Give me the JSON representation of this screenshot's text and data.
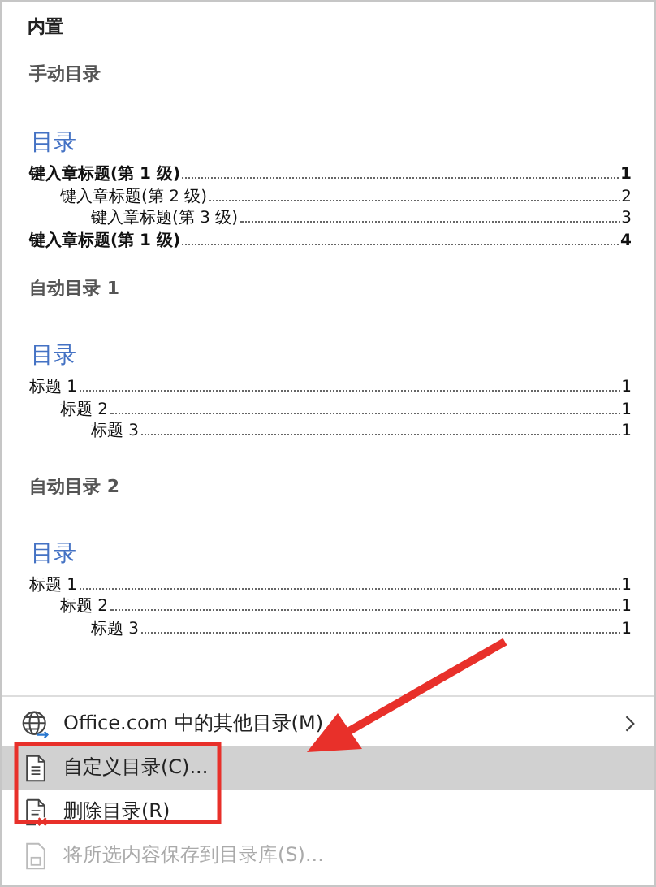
{
  "header": "内置",
  "gallery": [
    {
      "title": "手动目录",
      "toc_title": "目录",
      "entries": [
        {
          "text": "键入章标题(第 1 级)",
          "page": "1",
          "bold": true,
          "children": [
            {
              "text": "键入章标题(第 2 级)",
              "page": "2",
              "bold": false,
              "children": [
                {
                  "text": "键入章标题(第 3 级)",
                  "page": "3",
                  "bold": false
                }
              ]
            }
          ]
        },
        {
          "text": "键入章标题(第 1 级)",
          "page": "4",
          "bold": true
        }
      ]
    },
    {
      "title": "自动目录 1",
      "toc_title": "目录",
      "entries": [
        {
          "text": "标题 1",
          "page": "1",
          "bold": false,
          "children": [
            {
              "text": "标题 2",
              "page": "1",
              "bold": false,
              "children": [
                {
                  "text": "标题 3",
                  "page": "1",
                  "bold": false
                }
              ]
            }
          ]
        }
      ]
    },
    {
      "title": "自动目录 2",
      "toc_title": "目录",
      "entries": [
        {
          "text": "标题 1",
          "page": "1",
          "bold": false,
          "children": [
            {
              "text": "标题 2",
              "page": "1",
              "bold": false,
              "children": [
                {
                  "text": "标题 3",
                  "page": "1",
                  "bold": false
                }
              ]
            }
          ]
        }
      ]
    }
  ],
  "menu": [
    {
      "label": "Office.com 中的其他目录(M)",
      "kind": "globe",
      "submenu": true,
      "selected": false,
      "disabled": false
    },
    {
      "label": "自定义目录(C)...",
      "kind": "document",
      "submenu": false,
      "selected": true,
      "disabled": false
    },
    {
      "label": "删除目录(R)",
      "kind": "delete",
      "submenu": false,
      "selected": false,
      "disabled": false
    },
    {
      "label": "将所选内容保存到目录库(S)...",
      "kind": "save",
      "submenu": false,
      "selected": false,
      "disabled": true
    }
  ]
}
